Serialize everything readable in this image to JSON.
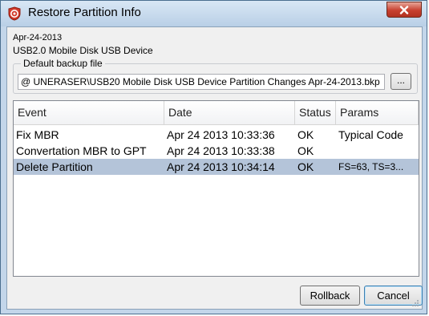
{
  "window": {
    "title": "Restore Partition Info",
    "app_icon": "at-sign-shield-icon",
    "close_icon": "close-icon"
  },
  "info": {
    "date": "Apr-24-2013",
    "device": "USB2.0 Mobile Disk USB Device"
  },
  "backup": {
    "group_label": "Default backup file",
    "path_value": "@ UNERASER\\USB20 Mobile Disk USB Device Partition Changes Apr-24-2013.bkp",
    "browse_label": "..."
  },
  "table": {
    "columns": [
      "Event",
      "Date",
      "Status",
      "Params"
    ],
    "rows": [
      {
        "event": "Fix MBR",
        "date": "Apr 24 2013 10:33:36",
        "status": "OK",
        "params": "Typical Code",
        "selected": false
      },
      {
        "event": "Convertation MBR to GPT",
        "date": "Apr 24 2013 10:33:38",
        "status": "OK",
        "params": "",
        "selected": false
      },
      {
        "event": "Delete Partition",
        "date": "Apr 24 2013 10:34:14",
        "status": "OK",
        "params": "FS=63, TS=3...",
        "selected": true
      }
    ]
  },
  "buttons": {
    "rollback": "Rollback",
    "cancel": "Cancel"
  },
  "colors": {
    "selection": "#b4c4d9",
    "close_button": "#c7402f",
    "frame": "#c3d6ea"
  }
}
